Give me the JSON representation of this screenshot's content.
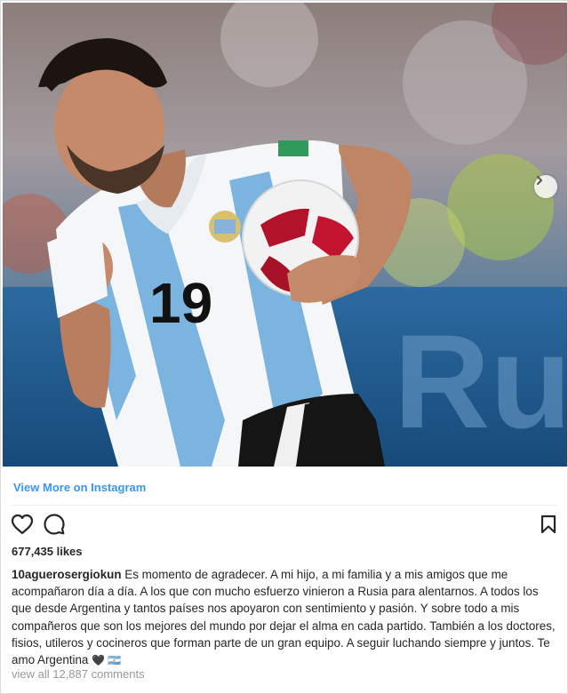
{
  "post": {
    "view_more_label": "View More on Instagram",
    "likes": "677,435 likes",
    "username": "10aguerosergiokun",
    "caption": "Es momento de agradecer. A mi hijo, a mi familia y a mis amigos que me acompañaron día a día. A los que con mucho esfuerzo vinieron a Rusia para alentarnos. A todos los que desde Argentina y tantos países nos apoyaron con sentimiento y pasión. Y sobre todo a mis compañeros que son los mejores del mundo por dejar el alma en cada partido. También a los doctores, fisios, utileros y cocineros que forman parte de un gran equipo. A seguir luchando siempre y juntos. Te amo Argentina",
    "caption_emojis": "🖤 🇦🇷",
    "view_comments_label": "view all 12,887 comments",
    "jersey_number": "19",
    "banner_text": "Ru"
  },
  "icons": {
    "like": "heart-icon",
    "comment": "comment-bubble-icon",
    "save": "bookmark-icon",
    "next": "chevron-right-icon"
  },
  "colors": {
    "link": "#3897f0",
    "text": "#262626",
    "muted": "#999999",
    "jersey_stripe": "#7cb4e0"
  }
}
